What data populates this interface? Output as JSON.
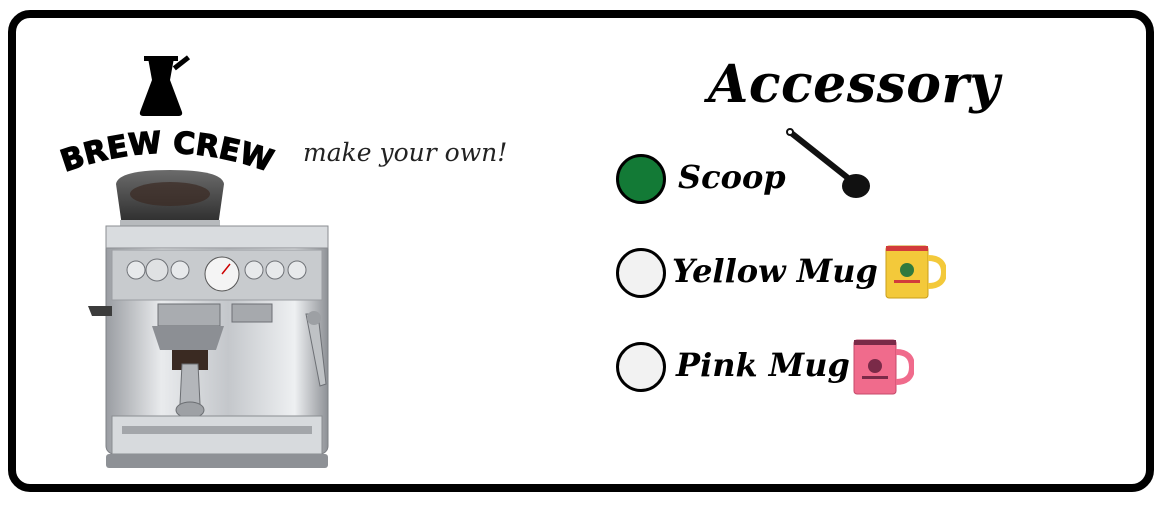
{
  "brand": {
    "logo_text": "BREW CREW",
    "tagline": "make your own!"
  },
  "product_image": {
    "icon": "espresso-machine"
  },
  "accessory": {
    "title": "Accessory",
    "options": [
      {
        "label": "Scoop",
        "selected": true,
        "icon": "scoop-icon"
      },
      {
        "label": "Yellow Mug",
        "selected": false,
        "icon": "yellow-mug-icon"
      },
      {
        "label": "Pink Mug",
        "selected": false,
        "icon": "pink-mug-icon"
      }
    ]
  },
  "colors": {
    "selected": "#137a36",
    "unselected": "#f2f2f2",
    "border": "#000000",
    "mug_yellow": "#f3c93a",
    "mug_pink": "#f06b8c"
  }
}
